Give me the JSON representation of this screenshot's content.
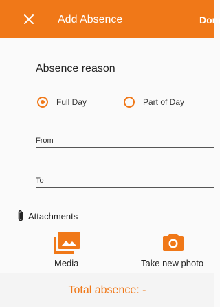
{
  "appbar": {
    "title": "Add Absence",
    "done_label": "Done",
    "color": "#f07818"
  },
  "form": {
    "reason_label": "Absence reason",
    "duration_options": [
      {
        "label": "Full Day",
        "selected": true
      },
      {
        "label": "Part of Day",
        "selected": false
      }
    ],
    "from_label": "From",
    "to_label": "To"
  },
  "attachments": {
    "label": "Attachments",
    "icon": "paperclip-icon",
    "actions": [
      {
        "label": "Media",
        "icon": "image-icon"
      },
      {
        "label": "Take new photo",
        "icon": "camera-icon"
      }
    ]
  },
  "footer": {
    "total_label": "Total absence: -"
  }
}
